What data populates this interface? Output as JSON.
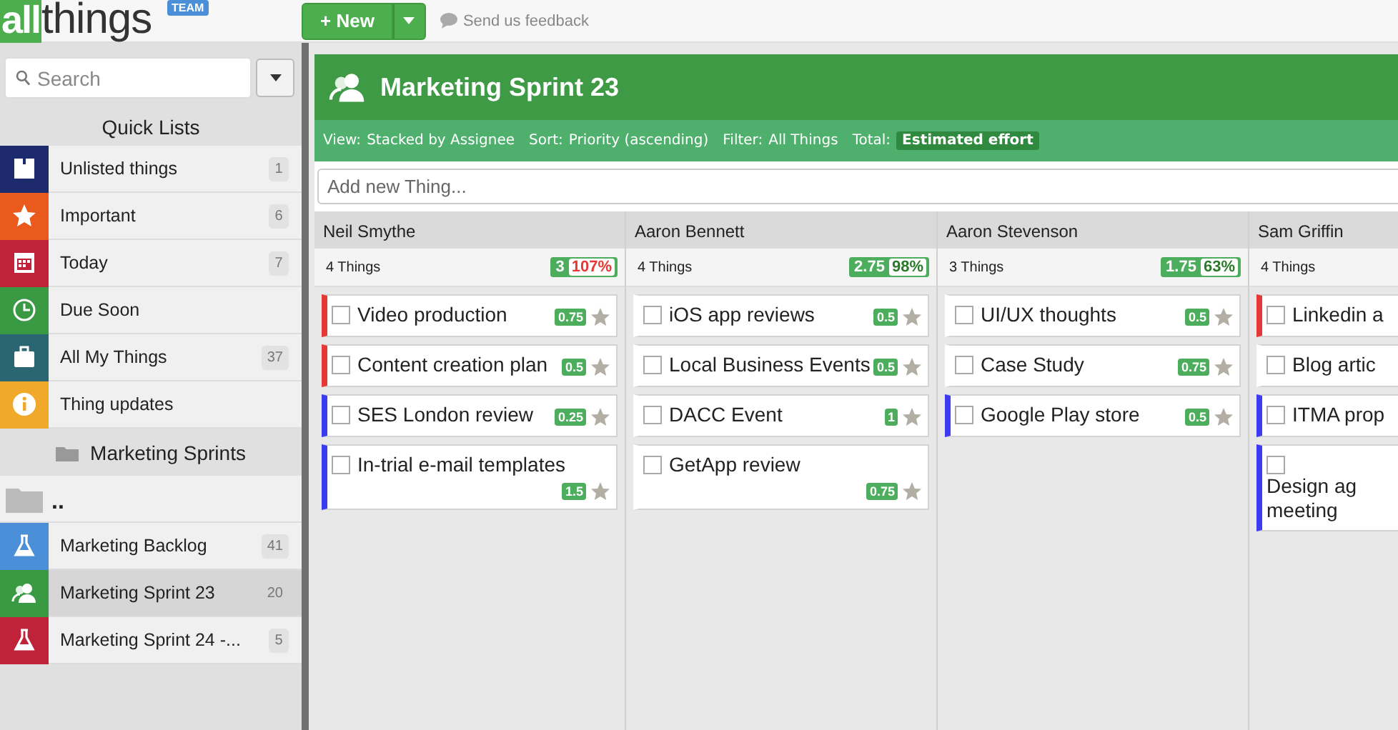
{
  "header": {
    "logo_left": "all",
    "logo_right": "things",
    "edition_badge": "TEAM",
    "new_button": "+ New",
    "feedback": "Send us feedback"
  },
  "sidebar": {
    "search": {
      "placeholder": "Search"
    },
    "quick_lists_title": "Quick Lists",
    "quick_lists": [
      {
        "label": "Unlisted things",
        "count": "1",
        "kind": "box",
        "color": "#1d2a6b",
        "selected": false
      },
      {
        "label": "Important",
        "count": "6",
        "kind": "star",
        "color": "#ea5a1c",
        "selected": false
      },
      {
        "label": "Today",
        "count": "7",
        "kind": "calendar",
        "color": "#c0223a",
        "selected": false
      },
      {
        "label": "Due Soon",
        "kind": "clock",
        "color": "#3a9a44",
        "selected": false
      },
      {
        "label": "All My Things",
        "count": "37",
        "kind": "briefcase",
        "color": "#2a6572",
        "selected": false
      },
      {
        "label": "Thing updates",
        "kind": "info",
        "color": "#f0a92a",
        "selected": false
      }
    ],
    "folder_title": "Marketing Sprints",
    "parent_folder": "..",
    "lists": [
      {
        "label": "Marketing Backlog",
        "count": "41",
        "kind": "flask",
        "color": "#4a8fd8",
        "selected": false
      },
      {
        "label": "Marketing Sprint 23",
        "count": "20",
        "kind": "team",
        "color": "#3a9a44",
        "selected": true
      },
      {
        "label": "Marketing Sprint 24 -...",
        "count": "5",
        "kind": "flask",
        "color": "#c0223a",
        "selected": false
      }
    ]
  },
  "board": {
    "title": "Marketing Sprint 23",
    "filters": [
      {
        "label": "View:",
        "value": "Stacked by Assignee",
        "highlighted": false
      },
      {
        "label": "Sort:",
        "value": "Priority (ascending)",
        "highlighted": false
      },
      {
        "label": "Filter:",
        "value": "All Things",
        "highlighted": false
      },
      {
        "label": "Total:",
        "value": "Estimated effort",
        "highlighted": true
      }
    ],
    "add_field": {
      "placeholder": "Add new Thing..."
    },
    "columns": [
      {
        "assignee": "Neil Smythe",
        "count": "4 Things",
        "total": "3",
        "percent": "107%",
        "over_capacity": true,
        "things": [
          {
            "title": "Video production",
            "effort": "0.75",
            "color": "#e53935",
            "checked": false,
            "starred": false
          },
          {
            "title": "Content creation plan",
            "effort": "0.5",
            "color": "#e53935",
            "checked": false,
            "starred": false
          },
          {
            "title": "SES London review",
            "effort": "0.25",
            "color": "#3b3bf0",
            "checked": false,
            "starred": false
          },
          {
            "title": "In-trial e-mail templates",
            "effort": "1.5",
            "color": "#3b3bf0",
            "checked": false,
            "starred": false
          }
        ]
      },
      {
        "assignee": "Aaron Bennett",
        "count": "4 Things",
        "total": "2.75",
        "percent": "98%",
        "over_capacity": false,
        "things": [
          {
            "title": "iOS app reviews",
            "effort": "0.5",
            "checked": false,
            "starred": false
          },
          {
            "title": "Local Business Events",
            "effort": "0.5",
            "checked": false,
            "starred": false
          },
          {
            "title": "DACC Event",
            "effort": "1",
            "checked": false,
            "starred": false
          },
          {
            "title": "GetApp review",
            "effort": "0.75",
            "checked": false,
            "starred": false
          }
        ]
      },
      {
        "assignee": "Aaron Stevenson",
        "count": "3 Things",
        "total": "1.75",
        "percent": "63%",
        "over_capacity": false,
        "things": [
          {
            "title": "UI/UX thoughts",
            "effort": "0.5",
            "checked": false,
            "starred": false
          },
          {
            "title": "Case Study",
            "effort": "0.75",
            "checked": false,
            "starred": false
          },
          {
            "title": "Google Play store",
            "effort": "0.5",
            "color": "#3b3bf0",
            "checked": false,
            "starred": false
          }
        ]
      },
      {
        "assignee": "Sam Griffin",
        "count": "4 Things",
        "things": [
          {
            "title": "Linkedin a",
            "color": "#e53935",
            "checked": false
          },
          {
            "title": "Blog artic",
            "checked": false
          },
          {
            "title": "ITMA prop",
            "color": "#3b3bf0",
            "checked": false
          },
          {
            "title": "Design ag meeting",
            "color": "#3b3bf0",
            "checked": false
          }
        ]
      }
    ]
  }
}
